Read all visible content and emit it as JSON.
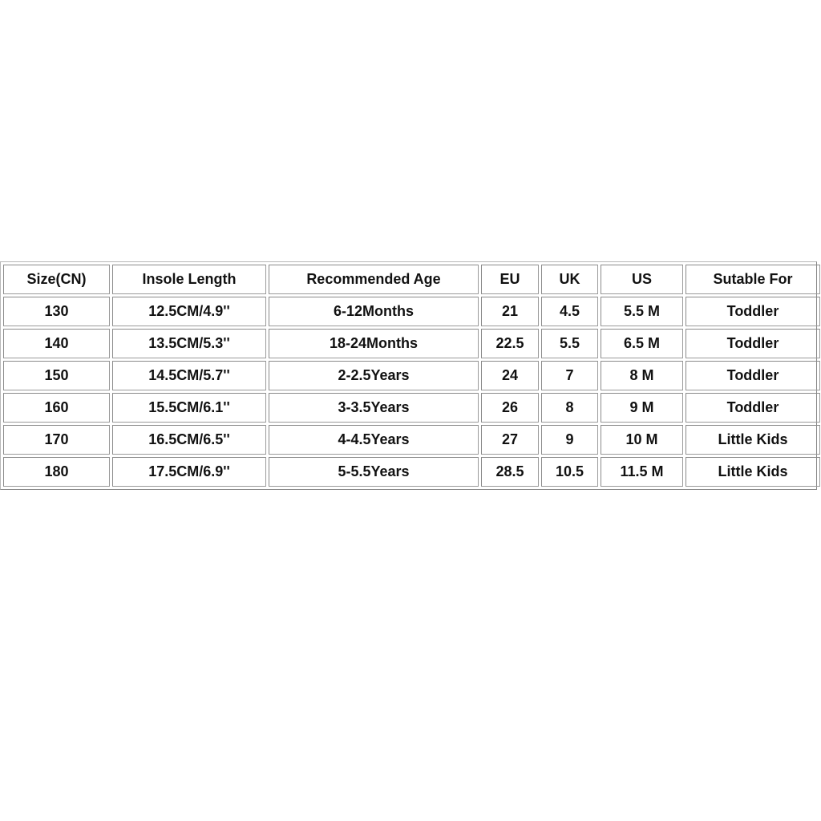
{
  "table": {
    "headers": [
      "Size(CN)",
      "Insole Length",
      "Recommended Age",
      "EU",
      "UK",
      "US",
      "Sutable For"
    ],
    "rows": [
      [
        "130",
        "12.5CM/4.9''",
        "6-12Months",
        "21",
        "4.5",
        "5.5 M",
        "Toddler"
      ],
      [
        "140",
        "13.5CM/5.3''",
        "18-24Months",
        "22.5",
        "5.5",
        "6.5 M",
        "Toddler"
      ],
      [
        "150",
        "14.5CM/5.7''",
        "2-2.5Years",
        "24",
        "7",
        "8 M",
        "Toddler"
      ],
      [
        "160",
        "15.5CM/6.1''",
        "3-3.5Years",
        "26",
        "8",
        "9 M",
        "Toddler"
      ],
      [
        "170",
        "16.5CM/6.5''",
        "4-4.5Years",
        "27",
        "9",
        "10 M",
        "Little Kids"
      ],
      [
        "180",
        "17.5CM/6.9''",
        "5-5.5Years",
        "28.5",
        "10.5",
        "11.5 M",
        "Little Kids"
      ]
    ]
  }
}
